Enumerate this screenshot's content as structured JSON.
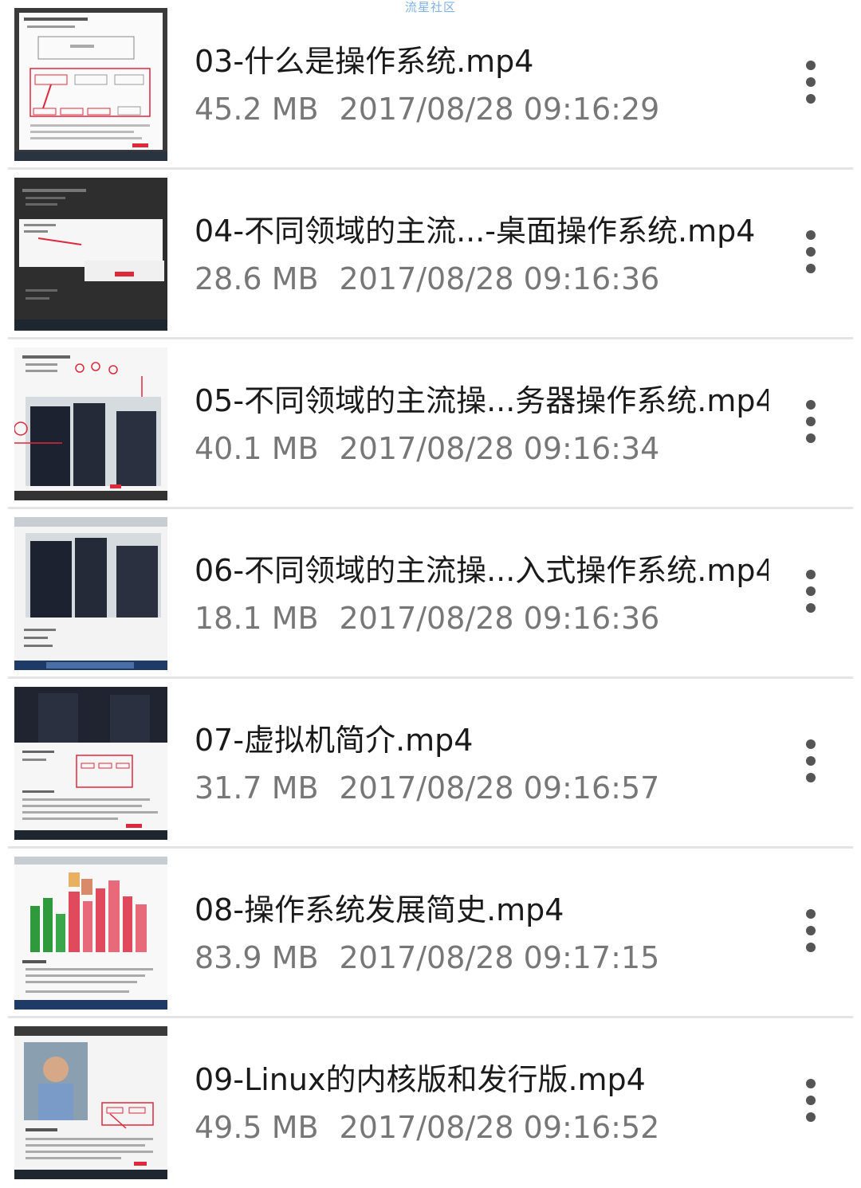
{
  "watermark": "流星社区",
  "files": [
    {
      "name": "03-什么是操作系统.mp4",
      "size": "45.2 MB",
      "date": "2017/08/28 09:16:29",
      "thumb": "document"
    },
    {
      "name": "04-不同领域的主流...-桌面操作系统.mp4",
      "size": "28.6 MB",
      "date": "2017/08/28 09:16:36",
      "thumb": "dark-slide"
    },
    {
      "name": "05-不同领域的主流操...务器操作系统.mp4",
      "size": "40.1 MB",
      "date": "2017/08/28 09:16:34",
      "thumb": "server-room"
    },
    {
      "name": "06-不同领域的主流操...入式操作系统.mp4",
      "size": "18.1 MB",
      "date": "2017/08/28 09:16:36",
      "thumb": "server-room-window"
    },
    {
      "name": "07-虚拟机简介.mp4",
      "size": "31.7 MB",
      "date": "2017/08/28 09:16:57",
      "thumb": "vm-slide"
    },
    {
      "name": "08-操作系统发展简史.mp4",
      "size": "83.9 MB",
      "date": "2017/08/28 09:17:15",
      "thumb": "history-chart"
    },
    {
      "name": "09-Linux的内核版和发行版.mp4",
      "size": "49.5 MB",
      "date": "2017/08/28 09:16:52",
      "thumb": "portrait-slide"
    }
  ],
  "icons": {
    "more": "more-vertical-icon"
  },
  "colors": {
    "title": "#1a1a1a",
    "meta": "#777777",
    "accent_red": "#e0283c",
    "divider": "#e4e4e4"
  }
}
